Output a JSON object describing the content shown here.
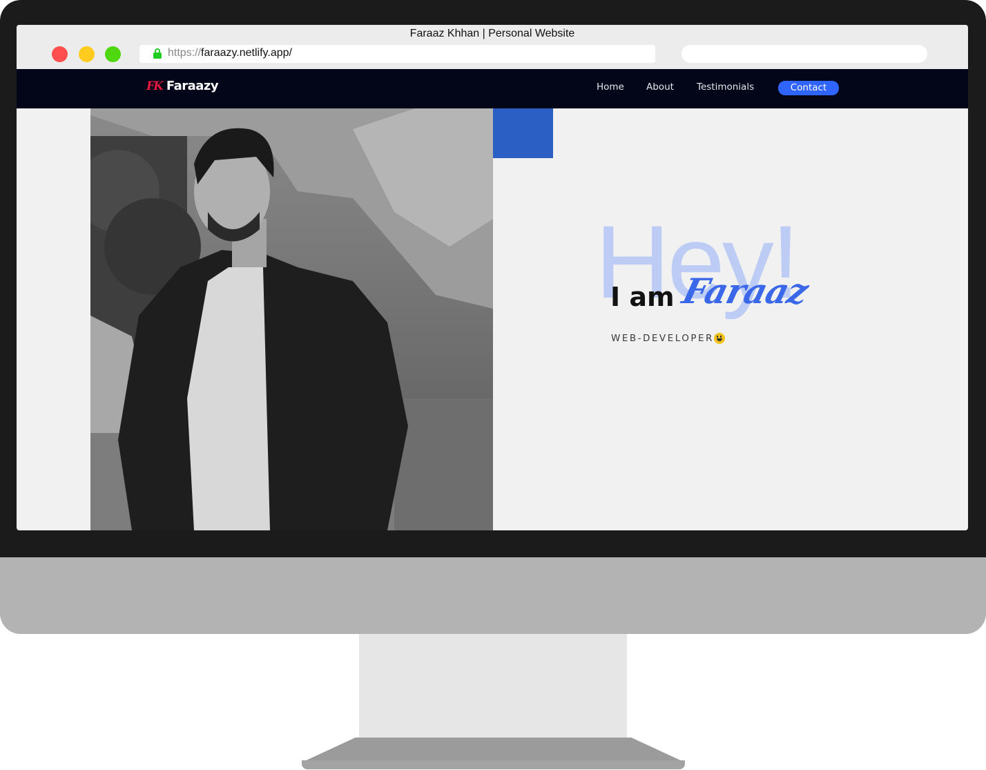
{
  "browser": {
    "window_title": "Faraaz Khhan | Personal Website",
    "url_scheme": "https://",
    "url_host": "faraazy.netlify.app/"
  },
  "site": {
    "logo_mark": "FK",
    "logo_text": "Faraazy",
    "nav": {
      "home": "Home",
      "about": "About",
      "testimonials": "Testimonials",
      "contact": "Contact"
    }
  },
  "hero": {
    "greeting": "Hey!",
    "intro": "I am",
    "name": "Faraaz",
    "role": "WEB-DEVELOPER!",
    "role_emoji_icon": "smiley-icon"
  },
  "colors": {
    "navbar": "#020618",
    "accent": "#2f64ff",
    "logo_mark": "#e2183f",
    "greeting": "#bcccf4",
    "name": "#3b68e8"
  }
}
